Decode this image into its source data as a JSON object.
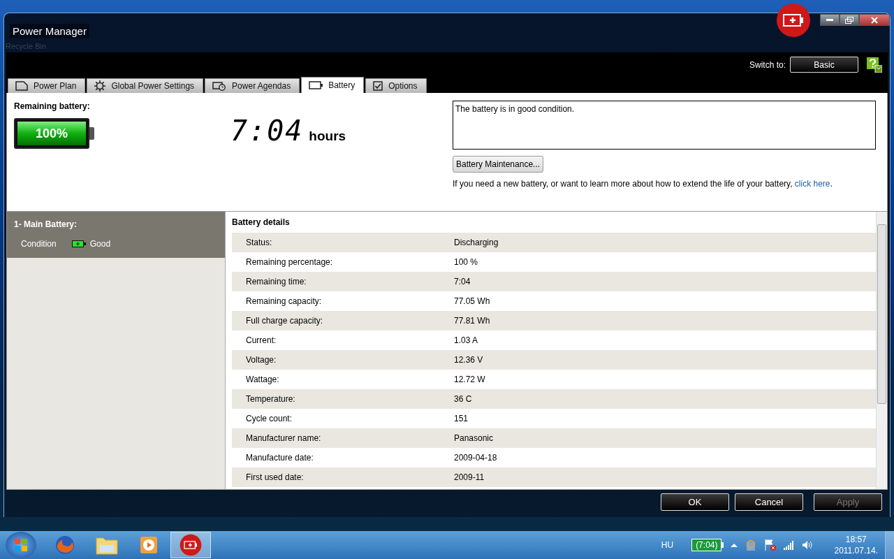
{
  "desktop": {
    "icon_label": "Recycle Bin"
  },
  "window": {
    "title": "Power Manager"
  },
  "switch_to": {
    "label": "Switch to:",
    "button": "Basic"
  },
  "tabs": [
    {
      "label": "Power Plan",
      "kind": "plan",
      "selected": false
    },
    {
      "label": "Global Power Settings",
      "kind": "gear",
      "selected": false
    },
    {
      "label": "Power Agendas",
      "kind": "agenda",
      "selected": false
    },
    {
      "label": "Battery",
      "kind": "battery",
      "selected": true
    },
    {
      "label": "Options",
      "kind": "check",
      "selected": false
    }
  ],
  "summary": {
    "heading": "Remaining battery:",
    "percent": "100%",
    "level": 1,
    "time": "7:04",
    "time_unit": "hours",
    "message": "The battery is in good condition.",
    "maintenance_button": "Battery Maintenance...",
    "hint": "If you need a new battery, or want to learn more about how to extend the life of your battery,",
    "link": "click here",
    "hint_end": "."
  },
  "batteries": [
    {
      "name": "1- Main Battery:",
      "condition_label": "Condition",
      "condition": "Good",
      "selected": true
    }
  ],
  "details": {
    "heading": "Battery details",
    "rows": [
      {
        "label": "Status:",
        "value": "Discharging"
      },
      {
        "label": "Remaining percentage:",
        "value": "100 %"
      },
      {
        "label": "Remaining time:",
        "value": "7:04"
      },
      {
        "label": "Remaining capacity:",
        "value": "77.05 Wh"
      },
      {
        "label": "Full charge capacity:",
        "value": "77.81 Wh"
      },
      {
        "label": "Current:",
        "value": "1.03 A"
      },
      {
        "label": "Voltage:",
        "value": "12.36 V"
      },
      {
        "label": "Wattage:",
        "value": "12.72 W"
      },
      {
        "label": "Temperature:",
        "value": "36 C"
      },
      {
        "label": "Cycle count:",
        "value": "151"
      },
      {
        "label": "Manufacturer name:",
        "value": "Panasonic"
      },
      {
        "label": "Manufacture date:",
        "value": "2009-04-18"
      },
      {
        "label": "First used date:",
        "value": "2009-11"
      }
    ]
  },
  "buttons": [
    {
      "label": "OK",
      "disabled": false
    },
    {
      "label": "Cancel",
      "disabled": false
    },
    {
      "label": "Apply",
      "disabled": true
    }
  ],
  "taskbar": {
    "apps": [
      {
        "kind": "browser",
        "active": false
      },
      {
        "kind": "folder",
        "active": false
      },
      {
        "kind": "media",
        "active": false
      },
      {
        "kind": "power",
        "active": true
      }
    ],
    "language": "HU",
    "battery_time": "(7:04)",
    "time": "18:57",
    "date": "2011.07.14."
  }
}
